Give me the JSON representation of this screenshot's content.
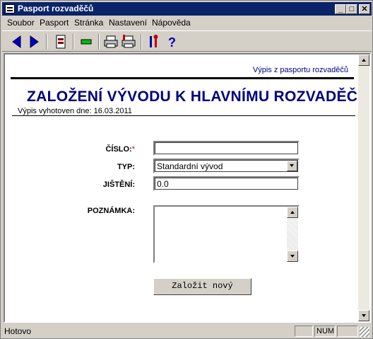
{
  "window": {
    "title": "Pasport rozvaděčů"
  },
  "menu": [
    "Soubor",
    "Pasport",
    "Stránka",
    "Nastavení",
    "Nápověda"
  ],
  "toolbar": {
    "icons": [
      "back-arrow-icon",
      "forward-arrow-icon",
      "document-icon",
      "minus-green-icon",
      "print-icon",
      "print-preview-icon",
      "settings-tools-icon",
      "help-question-icon"
    ]
  },
  "document": {
    "header_link": "Výpis z pasportu rozvaděčů",
    "title": "ZALOŽENÍ VÝVODU K HLAVNÍMU ROZVADĚČI",
    "date_line": "Výpis vyhotoven dne: 16.03.2011",
    "form": {
      "cislo_label": "ČÍSLO:",
      "required_mark": "*",
      "cislo_value": "",
      "typ_label": "TYP:",
      "typ_value": "Standardní vývod",
      "jisteni_label": "JIŠTĚNÍ:",
      "jisteni_value": "0.0",
      "poznamka_label": "POZNÁMKA:",
      "poznamka_value": "",
      "submit_label": "Založit nový"
    }
  },
  "status": {
    "text": "Hotovo",
    "num": "NUM"
  },
  "colors": {
    "title_bar": "#0a246a",
    "accent": "#000080",
    "required": "#c00000"
  }
}
